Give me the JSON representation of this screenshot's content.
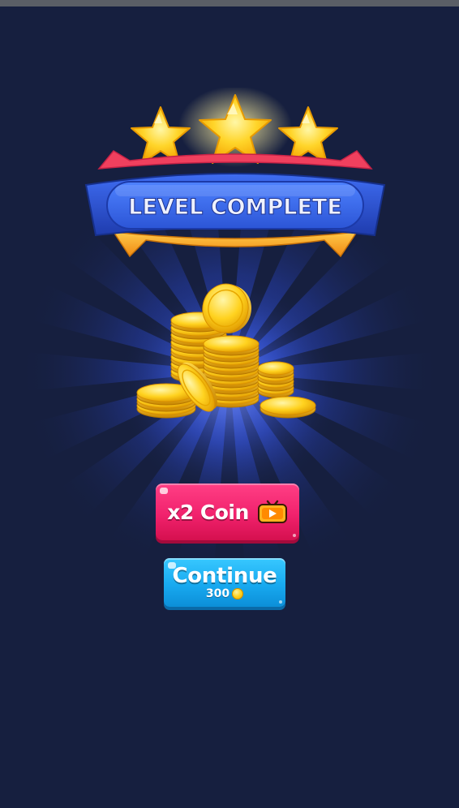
{
  "banner": {
    "title": "LEVEL COMPLETE",
    "stars_earned": 3,
    "stars_total": 3
  },
  "buttons": {
    "double_coin_label": "x2 Coin",
    "double_coin_icon": "tv-play-icon",
    "continue_label": "Continue",
    "continue_cost": "300",
    "continue_cost_icon": "coin-icon"
  },
  "colors": {
    "background": "#161f3f",
    "banner_blue": "#2e56d6",
    "ribbon_red": "#f0405e",
    "ribbon_gold": "#f7a81f",
    "pink_button": "#f1226d",
    "blue_button": "#18aaf0",
    "gold": "#ffd21f"
  }
}
